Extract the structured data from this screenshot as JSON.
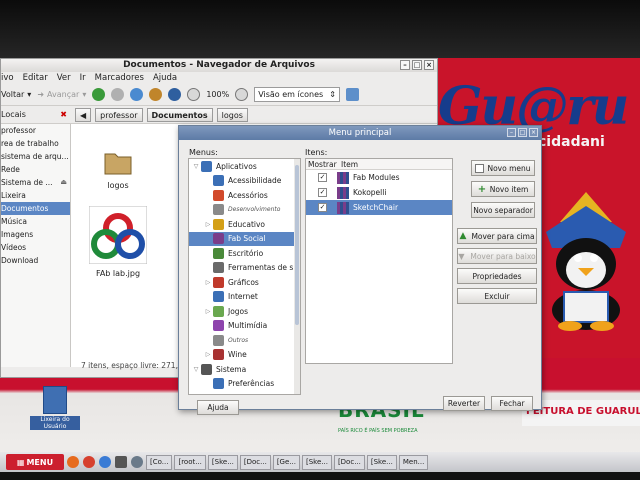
{
  "file_manager": {
    "title": "Documentos - Navegador de Arquivos",
    "menu": [
      "ivo",
      "Editar",
      "Ver",
      "Ir",
      "Marcadores",
      "Ajuda"
    ],
    "toolbar": {
      "back": "Voltar",
      "forward": "Avançar",
      "zoom": "100%",
      "view_mode": "Visão em ícones"
    },
    "location": {
      "places_label": "Locais",
      "crumbs": [
        "professor",
        "Documentos",
        "logos"
      ]
    },
    "sidebar": [
      {
        "label": "professor",
        "selected": false
      },
      {
        "label": "rea de trabalho",
        "selected": false
      },
      {
        "label": "sistema de arqu...",
        "selected": false
      },
      {
        "label": "Rede",
        "selected": false
      },
      {
        "label": "Sistema de ...",
        "selected": false,
        "eject": "⏏"
      },
      {
        "label": "Lixeira",
        "selected": false
      },
      {
        "label": "Documentos",
        "selected": true
      },
      {
        "label": "Música",
        "selected": false
      },
      {
        "label": "Imagens",
        "selected": false
      },
      {
        "label": "Vídeos",
        "selected": false
      },
      {
        "label": "Download",
        "selected": false
      }
    ],
    "files": [
      {
        "name": "logos",
        "icon": "folder-icon"
      },
      {
        "name": "FAb lab.jpg",
        "icon": "image-icon"
      }
    ],
    "status": "7 itens, espaço livre: 271,2 G"
  },
  "menu_dialog": {
    "title": "Menu principal",
    "menus_label": "Menus:",
    "items_label": "Itens:",
    "tree": [
      {
        "label": "Aplicativos",
        "level": 0,
        "expanded": true,
        "color": "#3b6fb6"
      },
      {
        "label": "Acessibilidade",
        "level": 1,
        "color": "#3b6fb6"
      },
      {
        "label": "Acessórios",
        "level": 1,
        "color": "#d24a2b"
      },
      {
        "label": "Desenvolvimento",
        "level": 1,
        "small": true,
        "color": "#8a8a8a"
      },
      {
        "label": "Educativo",
        "level": 1,
        "collapsed": true,
        "color": "#d4a017"
      },
      {
        "label": "Fab Social",
        "level": 1,
        "selected": true,
        "color": "#7a3d8a"
      },
      {
        "label": "Escritório",
        "level": 1,
        "color": "#4a8a3a"
      },
      {
        "label": "Ferramentas de si",
        "level": 1,
        "color": "#6a6a6a"
      },
      {
        "label": "Gráficos",
        "level": 1,
        "collapsed": true,
        "color": "#c0392b"
      },
      {
        "label": "Internet",
        "level": 1,
        "color": "#3b6fb6"
      },
      {
        "label": "Jogos",
        "level": 1,
        "collapsed": true,
        "color": "#6aa84f"
      },
      {
        "label": "Multimídia",
        "level": 1,
        "color": "#8e44ad"
      },
      {
        "label": "Outros",
        "level": 1,
        "small": true,
        "color": "#8a8a8a"
      },
      {
        "label": "Wine",
        "level": 1,
        "collapsed": true,
        "color": "#a83232"
      },
      {
        "label": "Sistema",
        "level": 0,
        "expanded": true,
        "color": "#555555"
      },
      {
        "label": "Preferências",
        "level": 1,
        "color": "#3b6fb6"
      }
    ],
    "columns": [
      "Mostrar",
      "Item"
    ],
    "items": [
      {
        "label": "Fab Modules",
        "checked": true,
        "selected": false
      },
      {
        "label": "Kokopelli",
        "checked": true,
        "selected": false
      },
      {
        "label": "SketchChair",
        "checked": true,
        "selected": true
      }
    ],
    "buttons": {
      "new_menu": "Novo menu",
      "new_item": "Novo item",
      "new_separator": "Novo separador",
      "move_up": "Mover para cima",
      "move_down": "Mover para baixo",
      "properties": "Propriedades",
      "delete": "Excluir",
      "help": "Ajuda",
      "revert": "Reverter",
      "close": "Fechar"
    }
  },
  "desktop": {
    "wallpaper_logo": "Gu@ru",
    "wallpaper_sub": "cidadani",
    "banner_city": "FEITURA DE GUARULHOS",
    "brasil_text": "BRASIL",
    "brasil_sub": "PAÍS RICO É PAÍS SEM POBREZA",
    "desk_icon_label": "Lixeira do Usuário"
  },
  "taskbar": {
    "start_label": "MENU",
    "tasks": [
      "[Co...",
      "[root...",
      "[Ske...",
      "[Doc...",
      "[Ge...",
      "[Ske...",
      "[Doc...",
      "[Ske...",
      "Men..."
    ]
  },
  "colors": {
    "accent": "#5b86c4",
    "dialog_title": "#6b88b1",
    "wallpaper_red": "#c9142a"
  }
}
